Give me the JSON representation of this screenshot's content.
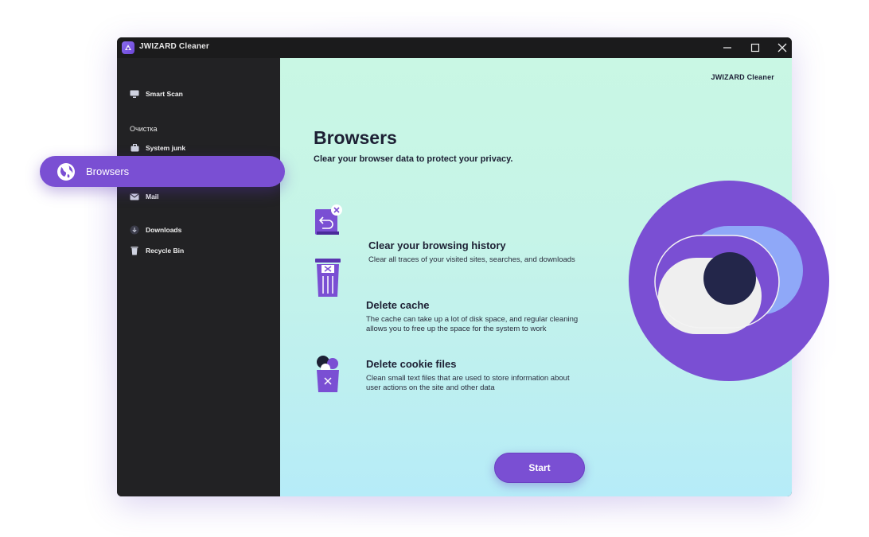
{
  "window": {
    "title": "JWIZARD Cleaner",
    "controls": [
      "minimize-icon",
      "maximize-icon",
      "close-icon"
    ]
  },
  "sidebar": {
    "items": [
      {
        "label": "Smart Scan",
        "icon": "monitor-icon"
      },
      {
        "label": "System junk",
        "icon": "briefcase-icon"
      },
      {
        "label": "Mail",
        "icon": "mail-icon"
      },
      {
        "label": "Downloads",
        "icon": "download-icon"
      },
      {
        "label": "Recycle Bin",
        "icon": "trash-icon"
      }
    ],
    "section_label": "Очистка",
    "active_item": {
      "label": "Browsers",
      "icon": "globe-icon"
    }
  },
  "main": {
    "brand": "JWIZARD Cleaner",
    "title": "Browsers",
    "subtitle": "Clear your browser data to protect your privacy.",
    "features": [
      {
        "title": "Clear your browsing history",
        "description": "Clear all traces of your visited sites, searches, and downloads",
        "icon": "history-book-icon"
      },
      {
        "title": "Delete cache",
        "description": "The cache can take up a lot of disk space, and regular cleaning allows you to free up the space for the system to work",
        "icon": "trash-can-icon"
      },
      {
        "title": "Delete cookie files",
        "description": "Clean small text files that are used to store information about user actions on the site and other data",
        "icon": "cookie-bin-icon"
      }
    ],
    "start_label": "Start"
  },
  "colors": {
    "accent": "#7a4fd3",
    "sidebar_bg": "#222224",
    "titlebar_bg": "#1b1b1c",
    "text_dark": "#1d2034"
  }
}
